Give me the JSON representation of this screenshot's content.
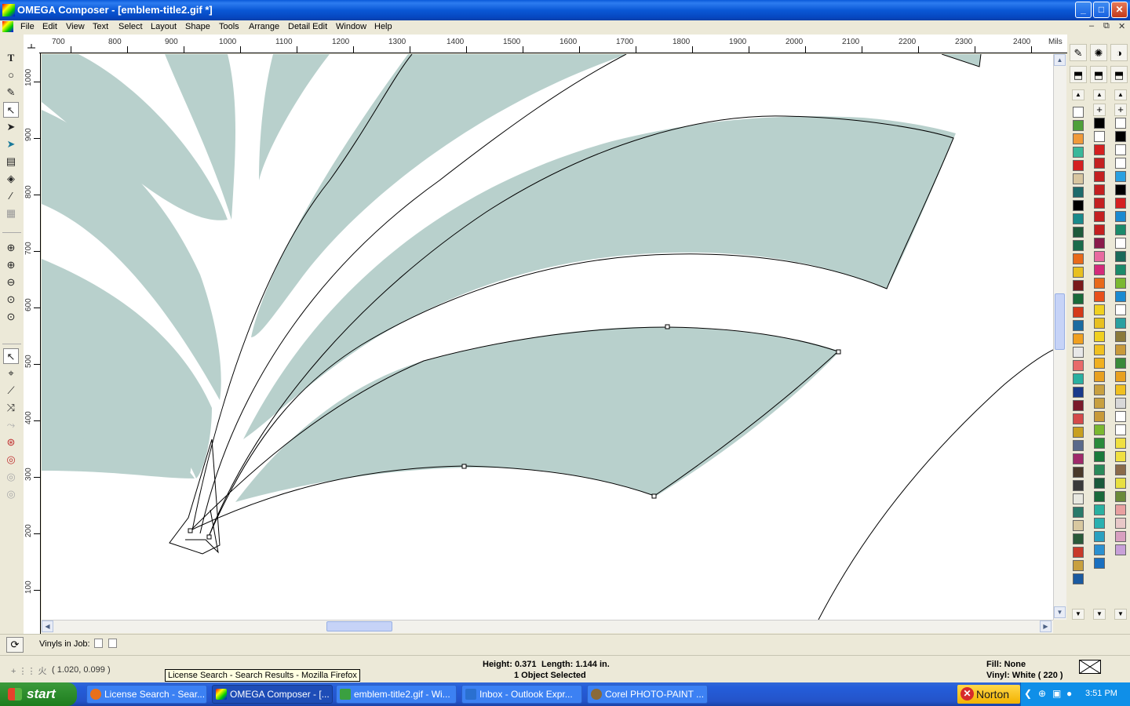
{
  "window": {
    "title": "OMEGA Composer - [emblem-title2.gif *]"
  },
  "menu": [
    "File",
    "Edit",
    "View",
    "Text",
    "Select",
    "Layout",
    "Shape",
    "Tools",
    "Arrange",
    "Detail Edit",
    "Window",
    "Help"
  ],
  "ruler": {
    "unit": "Mils",
    "h_ticks": [
      "700",
      "800",
      "900",
      "1000",
      "1100",
      "1200",
      "1300",
      "1400",
      "1500",
      "1600",
      "1700",
      "1800",
      "1900",
      "2000",
      "2100",
      "2200",
      "2300",
      "2400"
    ],
    "v_ticks": [
      "1000",
      "900",
      "800",
      "700",
      "600",
      "500",
      "400",
      "300",
      "200",
      "100"
    ]
  },
  "toolbox": [
    "text-icon",
    "ellipse-icon",
    "pen-icon",
    "node-edit-icon",
    "pointer-icon",
    "select-icon",
    "ruler-icon",
    "fill-icon",
    "eyedropper-icon",
    "texture-icon",
    "zoom-in-icon",
    "zoom-plus-icon",
    "zoom-minus-icon",
    "zoom-fit-icon",
    "zoom-page-icon",
    "arrow-select-icon",
    "node-icon",
    "line-icon",
    "connector-icon",
    "curve-icon",
    "weld-icon",
    "contour-icon",
    "trim-icon",
    "spiral-icon"
  ],
  "palette": {
    "col1": [
      "#ffffff",
      "#4ea03a",
      "#f09a3a",
      "#3ab89a",
      "#d42020",
      "#d8c6a0",
      "#1e6b6b",
      "#000000",
      "#1a8a8a",
      "#1e5a3a",
      "#1a6b4a",
      "#e86a1a",
      "#e8c020",
      "#7a1a1a",
      "#1a6b3a",
      "#d43a1a",
      "#1a6ba0",
      "#f0a020",
      "#e8e8e8",
      "#e86a6a",
      "#2ab0a0",
      "#1a3a8a",
      "#7a1a2a",
      "#d44a4a",
      "#c8a020",
      "#5a6a8a",
      "#a02a6a",
      "#4a3a2a",
      "#3a3a3a",
      "#e8e8e0",
      "#2a7a6a",
      "#d8c8a0",
      "#2a5a3a",
      "#c83a2a",
      "#c8a040",
      "#1a5aa0"
    ],
    "col2": [
      "#000000",
      "#ffffff",
      "#d42020",
      "#c42020",
      "#c42020",
      "#c42020",
      "#c42020",
      "#c42020",
      "#c42020",
      "#8a1a4a",
      "#e86aa0",
      "#d42a7a",
      "#e86a1a",
      "#e8501a",
      "#f0d020",
      "#e8c020",
      "#f0d020",
      "#f0c020",
      "#f0b020",
      "#e8a020",
      "#c8a040",
      "#c8a040",
      "#c89a3a",
      "#7ab830",
      "#2a8a3a",
      "#1a7a3a",
      "#2a8a5a",
      "#1a5a3a",
      "#1a6a3a",
      "#2ab0a0",
      "#2ab0b0",
      "#2aa0c0",
      "#2a90d0",
      "#1a70c0"
    ],
    "col3": [
      "#ffffff",
      "#000000",
      "#ffffff",
      "#ffffff",
      "#2aa0e0",
      "#000000",
      "#d42020",
      "#1a8ad0",
      "#1a8a6a",
      "#ffffff",
      "#1a6a5a",
      "#1a8a6a",
      "#7ab830",
      "#1a8ad0",
      "#ffffff",
      "#2aa0a0",
      "#8a7a3a",
      "#c89a3a",
      "#3a8a3a",
      "#e8a020",
      "#f0c020",
      "#d8d8d8",
      "#ffffff",
      "#ffffff",
      "#f0e040",
      "#f0e040",
      "#8a6a4a",
      "#e8e040",
      "#6a8a3a",
      "#e8a0a0",
      "#e8c8c8",
      "#d8a0c0",
      "#c8a0d8"
    ]
  },
  "status": {
    "vinyls_label": "Vinyls in Job:",
    "coords": "( 1.020, 0.099 )",
    "height": "Height: 0.371",
    "length": "Length: 1.144 in.",
    "selection": "1 Object Selected",
    "fill": "Fill: None",
    "vinyl": "Vinyl: White ( 220 )"
  },
  "tooltip": "License Search - Search Results - Mozilla Firefox",
  "taskbar": {
    "start": "start",
    "tasks": [
      {
        "label": "License Search - Sear...",
        "active": false,
        "color": "#e8701a"
      },
      {
        "label": "OMEGA Composer - [...",
        "active": true,
        "color": "#c8302a"
      },
      {
        "label": "emblem-title2.gif - Wi...",
        "active": false,
        "color": "#3aa040"
      },
      {
        "label": "Inbox - Outlook Expr...",
        "active": false,
        "color": "#2a70d0"
      },
      {
        "label": "Corel PHOTO-PAINT ...",
        "active": false,
        "color": "#8a6a3a"
      }
    ],
    "norton": "Norton",
    "clock": "3:51 PM"
  },
  "art": {
    "fill": "#b8d0cc"
  }
}
